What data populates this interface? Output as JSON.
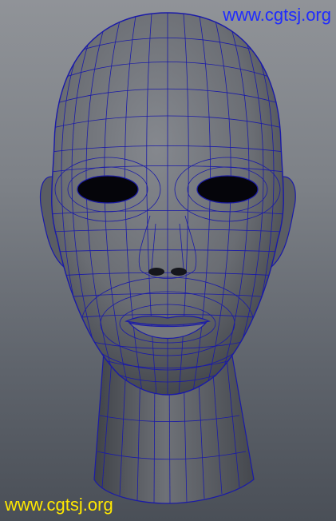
{
  "viewport": {
    "subject": "wireframe-head-model",
    "background_top": "#909398",
    "background_bottom": "#4a4f57",
    "mesh_color": "#1a1aa8",
    "surface_color": "#6f7278",
    "eye_color": "#05050a"
  },
  "watermarks": {
    "top": {
      "text": "www.cgtsj.org",
      "color": "#1f2bff"
    },
    "bottom": {
      "text": "www.cgtsj.org",
      "color": "#ffe800"
    }
  }
}
